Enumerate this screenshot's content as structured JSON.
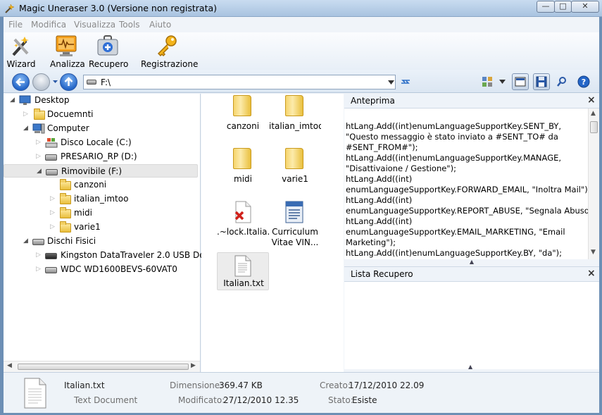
{
  "window": {
    "title": "Magic Uneraser 3.0   (Versione non registrata)"
  },
  "menu": [
    "File",
    "Modifica",
    "Visualizza",
    "Tools",
    "Aiuto"
  ],
  "toolbar": {
    "wizard": "Wizard",
    "analizza": "Analizza",
    "recupero": "Recupero",
    "registrazione": "Registrazione"
  },
  "address": {
    "path": "F:\\"
  },
  "tree": {
    "desktop": "Desktop",
    "documents": "Docuemnti",
    "computer": "Computer",
    "disk_c": "Disco Locale (C:)",
    "disk_d": "PRESARIO_RP (D:)",
    "disk_f": "Rimovibile (F:)",
    "canzoni": "canzoni",
    "italian_imtoo": "italian_imtoo",
    "midi": "midi",
    "varie1": "varie1",
    "physical": "Dischi Fisici",
    "kingston": "Kingston DataTraveler 2.0 USB Device",
    "wdc": "WDC WD1600BEVS-60VAT0"
  },
  "files": [
    {
      "name": "canzoni",
      "type": "folder"
    },
    {
      "name": "italian_imtoo",
      "type": "folder"
    },
    {
      "name": "midi",
      "type": "folder"
    },
    {
      "name": "varie1",
      "type": "folder"
    },
    {
      "name": ".~lock.Italia...",
      "type": "deleted-file"
    },
    {
      "name": "Curriculum",
      "name2": "Vitae VIN...",
      "type": "document"
    },
    {
      "name": "Italian.txt",
      "type": "text",
      "selected": true
    }
  ],
  "preview": {
    "title": "Anteprima",
    "lines": [
      "            htLang.Add((int)enumLanguageSupportKey.SENT_BY,",
      "\"Questo messaggio è stato inviato a #SENT_TO# da",
      "#SENT_FROM#\");",
      "            htLang.Add((int)enumLanguageSupportKey.MANAGE,",
      "\"Disattivaione / Gestione\");",
      "            htLang.Add((int)",
      "enumLanguageSupportKey.FORWARD_EMAIL, \"Inoltra Mail\");",
      "            htLang.Add((int)",
      "enumLanguageSupportKey.REPORT_ABUSE, \"Segnala Abuso\");",
      "            htLang.Add((int)",
      "enumLanguageSupportKey.EMAIL_MARKETING, \"Email",
      "Marketing\");",
      "            htLang.Add((int)enumLanguageSupportKey.BY, \"da\");"
    ]
  },
  "recovery": {
    "title": "Lista Recupero"
  },
  "status": {
    "filename": "Italian.txt",
    "filetype": "Text Document",
    "size_label": "Dimensione:",
    "size_value": "369.47 KB",
    "modified_label": "Modificato:",
    "modified_value": "27/12/2010 12.35",
    "created_label": "Creato:",
    "created_value": "17/12/2010 22.09",
    "state_label": "Stato:",
    "state_value": "Esiste"
  },
  "colors": {
    "accent": "#2466c8",
    "selection": "#e8e8e8"
  }
}
